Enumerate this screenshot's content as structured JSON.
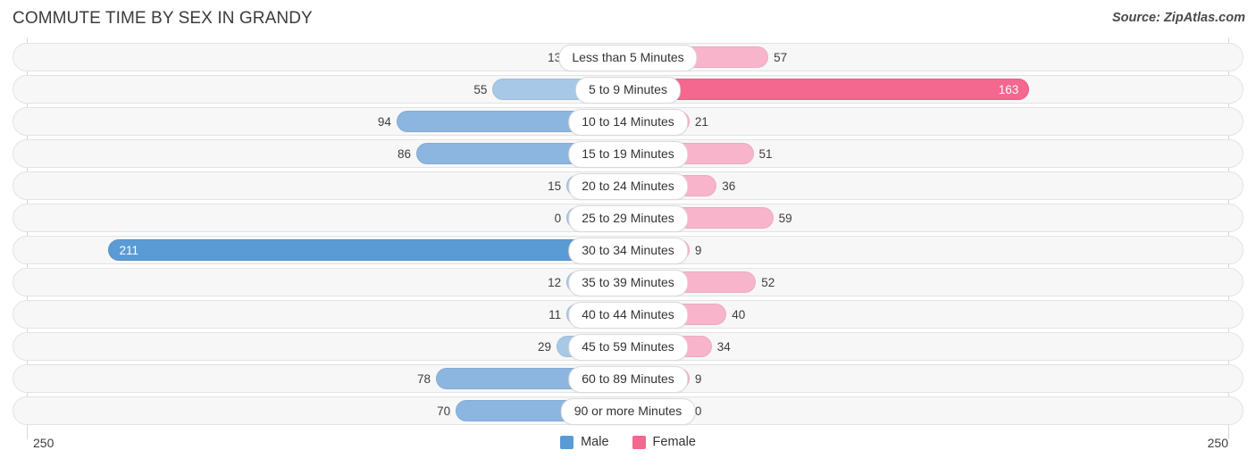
{
  "header": {
    "title": "COMMUTE TIME BY SEX IN GRANDY",
    "source": "Source: ZipAtlas.com"
  },
  "legend": {
    "items": [
      {
        "label": "Male",
        "color": "#5b9bd5"
      },
      {
        "label": "Female",
        "color": "#f4678f"
      }
    ]
  },
  "axis": {
    "left_max": "250",
    "right_max": "250"
  },
  "colors": {
    "male_light": "#a8c8e8",
    "male_mid": "#8cb6e0",
    "male_dark": "#5b9bd5",
    "female_light": "#f8b4cb",
    "female_mid": "#f693b4",
    "female_dark": "#f4678f",
    "track_bg": "#f7f7f7",
    "track_border": "#e3e3e3",
    "pill_bg": "#ffffff",
    "pill_border": "#d9d9d9"
  },
  "chart_data": {
    "type": "bar",
    "subtype": "diverging-horizontal-bar",
    "title": "COMMUTE TIME BY SEX IN GRANDY",
    "xlabel": "",
    "ylabel": "",
    "xlim": [
      -250,
      250
    ],
    "axis_max": 250,
    "grid": false,
    "legend_position": "bottom-center",
    "categories": [
      "Less than 5 Minutes",
      "5 to 9 Minutes",
      "10 to 14 Minutes",
      "15 to 19 Minutes",
      "20 to 24 Minutes",
      "25 to 29 Minutes",
      "30 to 34 Minutes",
      "35 to 39 Minutes",
      "40 to 44 Minutes",
      "45 to 59 Minutes",
      "60 to 89 Minutes",
      "90 or more Minutes"
    ],
    "series": [
      {
        "name": "Male",
        "direction": "left",
        "color": "#5b9bd5",
        "values": [
          13,
          55,
          94,
          86,
          15,
          0,
          211,
          12,
          11,
          29,
          78,
          70
        ]
      },
      {
        "name": "Female",
        "direction": "right",
        "color": "#f4678f",
        "values": [
          57,
          163,
          21,
          51,
          36,
          59,
          9,
          52,
          40,
          34,
          9,
          0
        ]
      }
    ]
  },
  "rows": [
    {
      "label": "Less than 5 Minutes",
      "male": "13",
      "female": "57",
      "male_value": 13,
      "female_value": 57
    },
    {
      "label": "5 to 9 Minutes",
      "male": "55",
      "female": "163",
      "male_value": 55,
      "female_value": 163
    },
    {
      "label": "10 to 14 Minutes",
      "male": "94",
      "female": "21",
      "male_value": 94,
      "female_value": 21
    },
    {
      "label": "15 to 19 Minutes",
      "male": "86",
      "female": "51",
      "male_value": 86,
      "female_value": 51
    },
    {
      "label": "20 to 24 Minutes",
      "male": "15",
      "female": "36",
      "male_value": 15,
      "female_value": 36
    },
    {
      "label": "25 to 29 Minutes",
      "male": "0",
      "female": "59",
      "male_value": 0,
      "female_value": 59
    },
    {
      "label": "30 to 34 Minutes",
      "male": "211",
      "female": "9",
      "male_value": 211,
      "female_value": 9
    },
    {
      "label": "35 to 39 Minutes",
      "male": "12",
      "female": "52",
      "male_value": 12,
      "female_value": 52
    },
    {
      "label": "40 to 44 Minutes",
      "male": "11",
      "female": "40",
      "male_value": 11,
      "female_value": 40
    },
    {
      "label": "45 to 59 Minutes",
      "male": "29",
      "female": "34",
      "male_value": 29,
      "female_value": 34
    },
    {
      "label": "60 to 89 Minutes",
      "male": "78",
      "female": "9",
      "male_value": 78,
      "female_value": 9
    },
    {
      "label": "90 or more Minutes",
      "male": "70",
      "female": "0",
      "male_value": 70,
      "female_value": 0
    }
  ]
}
